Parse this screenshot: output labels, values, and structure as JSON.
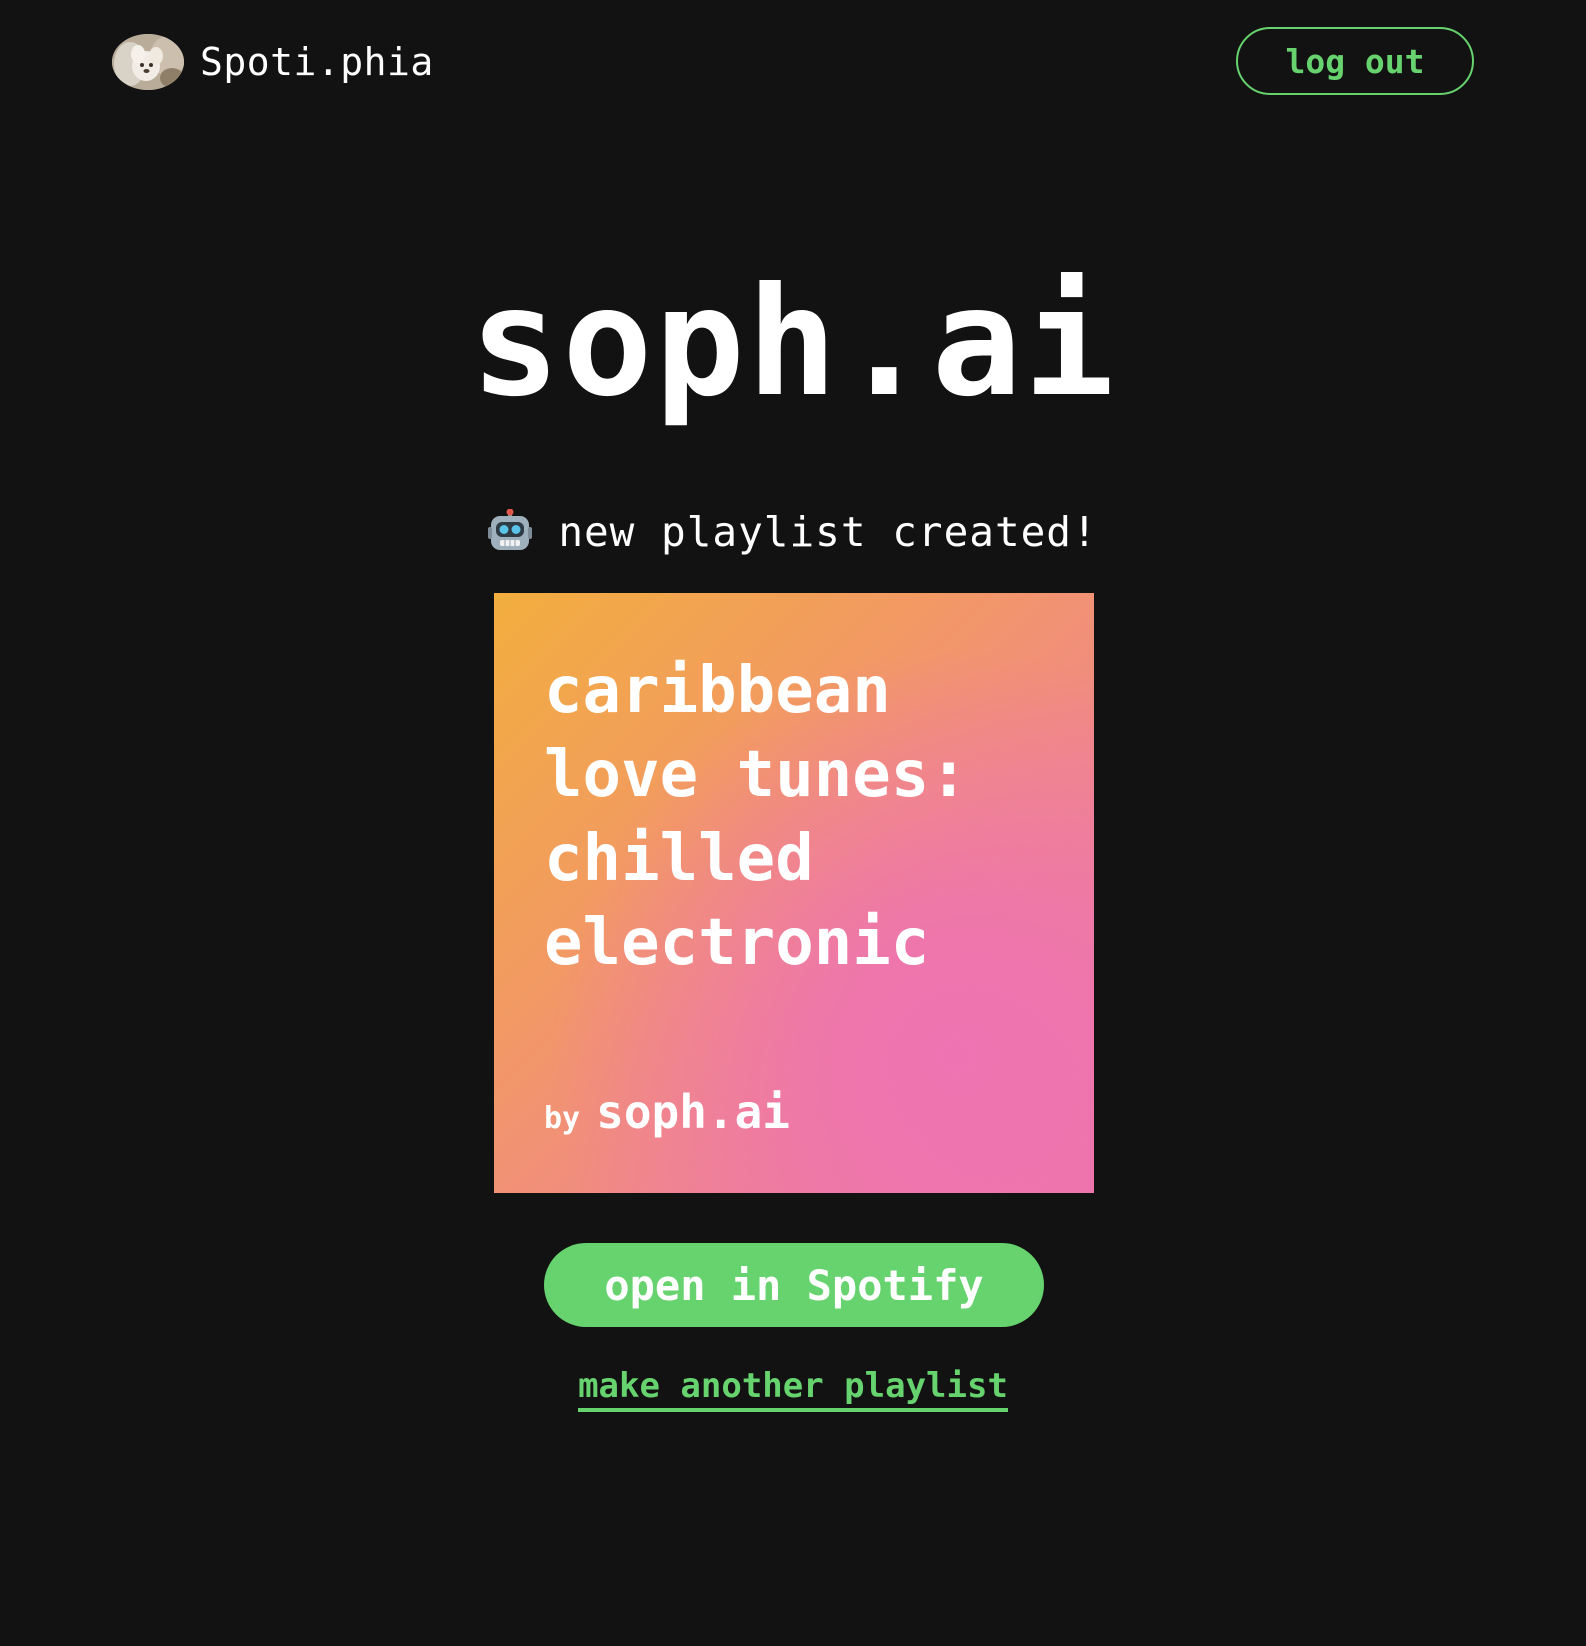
{
  "header": {
    "brand_name": "Spoti.phia",
    "logout_label": "log out"
  },
  "main": {
    "title": "soph.ai",
    "status_icon": "robot-icon",
    "status_text": "new playlist created!"
  },
  "playlist": {
    "title": "caribbean\nlove tunes:\nchilled\nelectronic",
    "credit_prefix": "by",
    "credit_name": "soph.ai",
    "gradient_colors": [
      "#f2ae3e",
      "#f08a84",
      "#ee73b2"
    ]
  },
  "actions": {
    "open_spotify_label": "open in Spotify",
    "make_another_label": "make another playlist"
  },
  "colors": {
    "background": "#121212",
    "accent": "#66d36e",
    "text": "#ffffff"
  }
}
